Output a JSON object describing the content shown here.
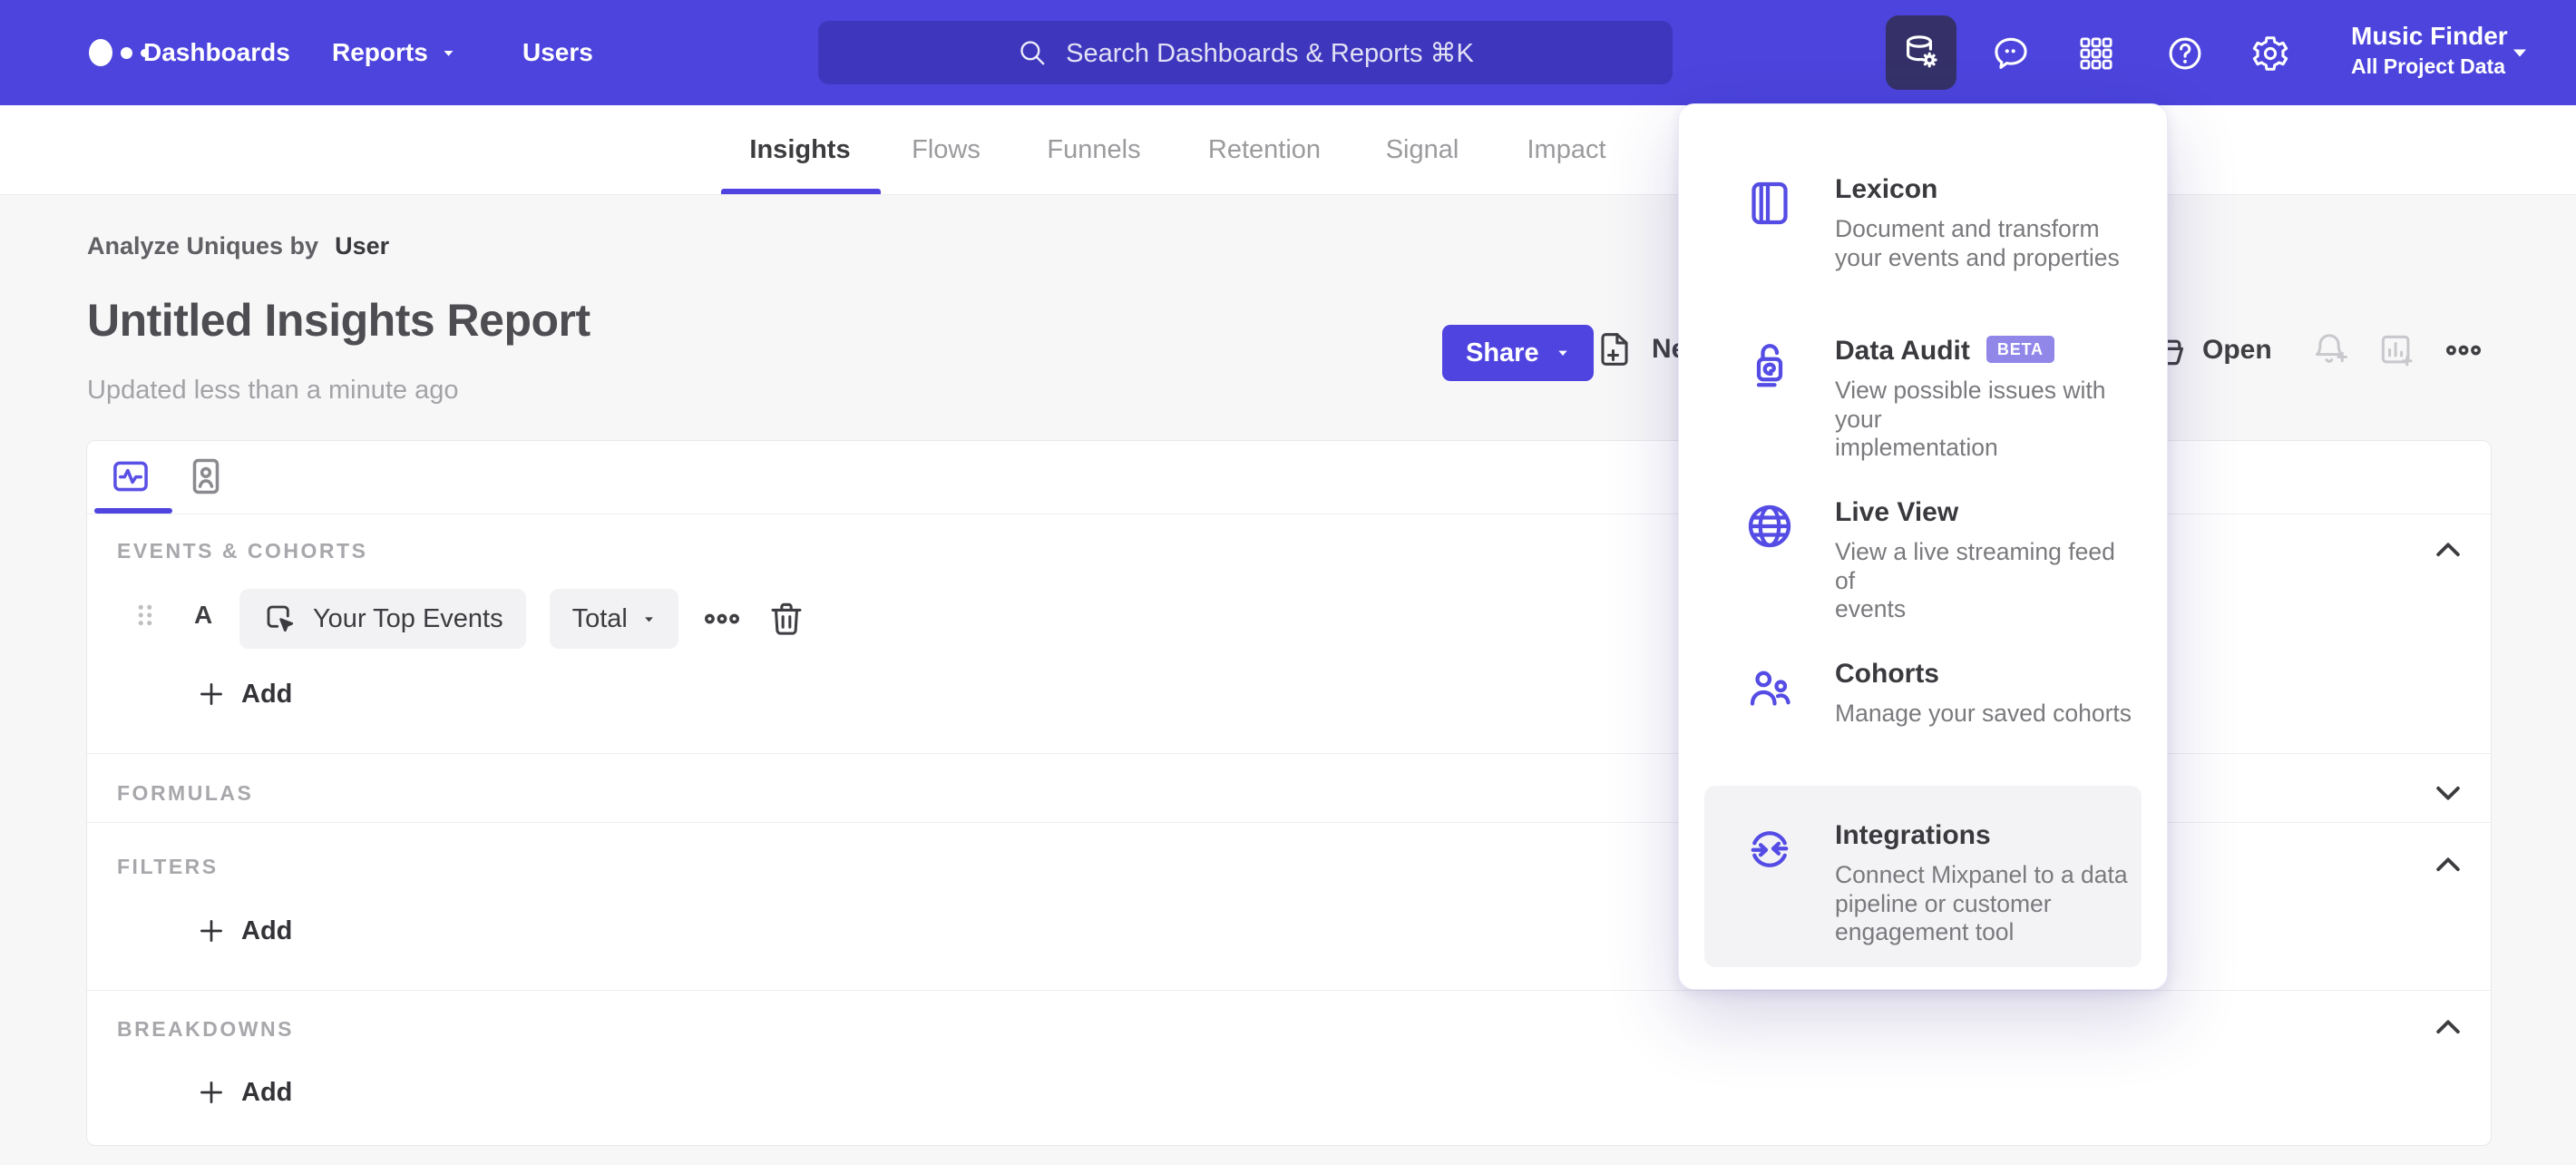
{
  "topnav": {
    "links": [
      {
        "label": "Dashboards"
      },
      {
        "label": "Reports"
      },
      {
        "label": "Users"
      }
    ],
    "search_placeholder": "Search Dashboards & Reports ⌘K",
    "project": {
      "name": "Music Finder",
      "scope": "All Project Data"
    }
  },
  "tabs": {
    "items": [
      {
        "label": "Insights"
      },
      {
        "label": "Flows"
      },
      {
        "label": "Funnels"
      },
      {
        "label": "Retention"
      },
      {
        "label": "Signal"
      },
      {
        "label": "Impact"
      }
    ]
  },
  "header": {
    "analyze_label": "Analyze Uniques by",
    "analyze_value": "User",
    "title": "Untitled Insights Report",
    "updated": "Updated less than a minute ago",
    "share_label": "Share",
    "new_label": "New",
    "open_label": "Open"
  },
  "builder": {
    "sections": {
      "events": "EVENTS & COHORTS",
      "formulas": "FORMULAS",
      "filters": "FILTERS",
      "breakdowns": "BREAKDOWNS"
    },
    "event_row": {
      "index": "A",
      "event": "Your Top Events",
      "metric": "Total"
    },
    "add_label": "Add"
  },
  "menu": {
    "items": [
      {
        "title": "Lexicon",
        "desc": "Document and transform\nyour events and properties"
      },
      {
        "title": "Data Audit",
        "badge": "BETA",
        "desc": "View possible issues with your\nimplementation"
      },
      {
        "title": "Live View",
        "desc": "View a live streaming feed of\nevents"
      },
      {
        "title": "Cohorts",
        "desc": "Manage your saved cohorts"
      },
      {
        "title": "Integrations",
        "desc": "Connect Mixpanel to a data\npipeline or customer\nengagement tool"
      }
    ]
  },
  "colors": {
    "brand": "#4f44e0",
    "topbar": "#4c44dc",
    "badge": "#9087e9"
  }
}
